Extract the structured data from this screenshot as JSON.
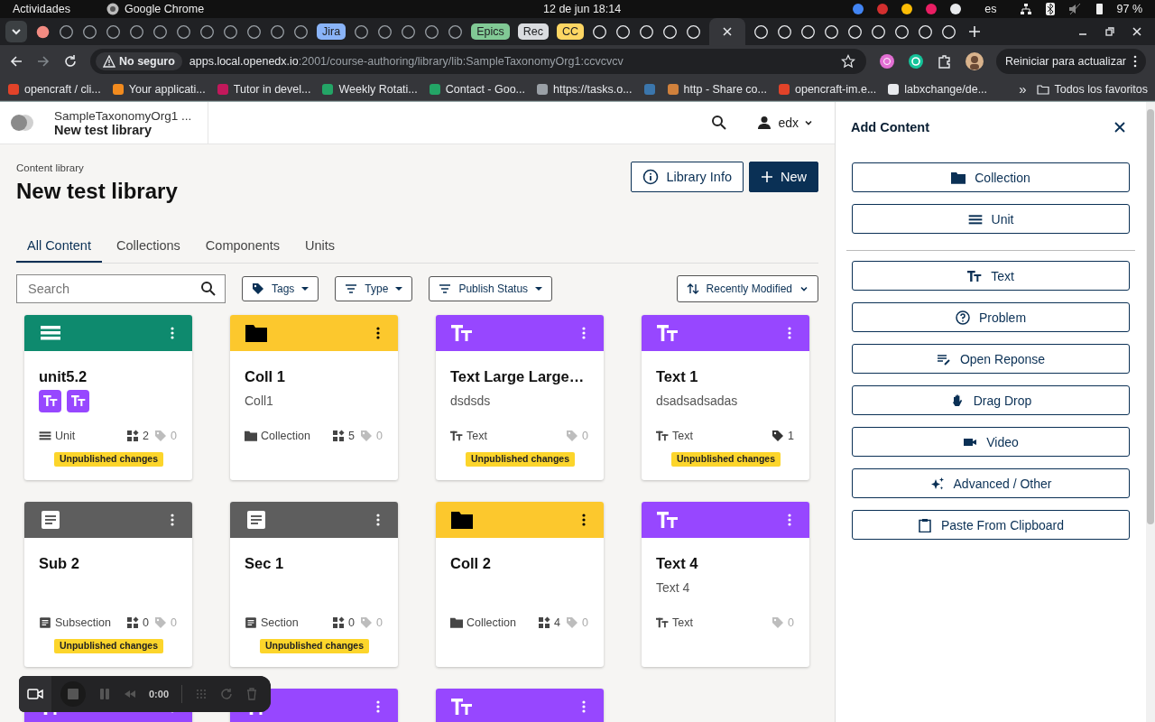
{
  "system_bar": {
    "activities": "Actividades",
    "app": "Google Chrome",
    "clock": "12 de jun  18:14",
    "language": "es",
    "battery": "97 %"
  },
  "browser": {
    "tab_groups": [
      {
        "label": "Jira",
        "color": "#8ab4f8"
      },
      {
        "label": "Epics",
        "color": "#81c995"
      },
      {
        "label": "Rec",
        "color": "#dadce0"
      },
      {
        "label": "CC",
        "color": "#fdd663"
      }
    ],
    "security": "No seguro",
    "url_host": "apps.local.openedx.io",
    "url_path": ":2001/course-authoring/library/lib:SampleTaxonomyOrg1:ccvcvcv",
    "update_button": "Reiniciar para actualizar",
    "bookmarks": [
      {
        "label": "opencraft / cli...",
        "color": "#e24329"
      },
      {
        "label": "Your applicati...",
        "color": "#f28b1e"
      },
      {
        "label": "Tutor in devel...",
        "color": "#c2185b"
      },
      {
        "label": "Weekly Rotati...",
        "color": "#23a566"
      },
      {
        "label": "Contact - Goo...",
        "color": "#23a566"
      },
      {
        "label": "https://tasks.o...",
        "color": "#9aa0a6"
      },
      {
        "color": "#3b76ac"
      },
      {
        "label": "http - Share co...",
        "color": "#d0813c"
      },
      {
        "label": "opencraft-im.e...",
        "color": "#e24329"
      },
      {
        "label": "labxchange/de...",
        "color": "#e8eaed"
      }
    ],
    "bookmarks_more": "»",
    "all_bookmarks": "Todos los favoritos"
  },
  "header": {
    "org": "SampleTaxonomyOrg1 ...",
    "library": "New test library",
    "user": "edx"
  },
  "page": {
    "breadcrumb": "Content library",
    "title": "New test library",
    "info_button": "Library Info",
    "new_button": "New"
  },
  "tabs": [
    {
      "label": "All Content",
      "selected": true
    },
    {
      "label": "Collections",
      "selected": false
    },
    {
      "label": "Components",
      "selected": false
    },
    {
      "label": "Units",
      "selected": false
    }
  ],
  "filters": {
    "search_placeholder": "Search",
    "buttons": [
      {
        "label": "Tags",
        "kind": "tag"
      },
      {
        "label": "Type",
        "kind": "filter"
      },
      {
        "label": "Publish Status",
        "kind": "filter"
      }
    ],
    "sort": "Recently Modified"
  },
  "cards": [
    {
      "kind": "unit",
      "title": "unit5.2",
      "children": [
        {
          "kind": "text"
        },
        {
          "kind": "text"
        }
      ],
      "type_label": "Unit",
      "components": "2",
      "tags": "0",
      "tagged": false,
      "unpublished": true,
      "badge": "Unpublished changes"
    },
    {
      "kind": "collection",
      "title": "Coll 1",
      "subtitle": "Coll1",
      "type_label": "Collection",
      "components": "5",
      "tags": "0",
      "tagged": false,
      "unpublished": false
    },
    {
      "kind": "text",
      "title": "Text Large Large…",
      "subtitle": "dsdsds",
      "type_label": "Text",
      "tags": "0",
      "tagged": false,
      "unpublished": true,
      "badge": "Unpublished changes"
    },
    {
      "kind": "text",
      "title": "Text 1",
      "subtitle": "dsadsadsadas",
      "type_label": "Text",
      "tags": "1",
      "tagged": true,
      "unpublished": true,
      "badge": "Unpublished changes"
    },
    {
      "kind": "subsection",
      "title": "Sub 2",
      "type_label": "Subsection",
      "components": "0",
      "tags": "0",
      "tagged": false,
      "unpublished": true,
      "badge": "Unpublished changes"
    },
    {
      "kind": "section",
      "title": "Sec 1",
      "type_label": "Section",
      "components": "0",
      "tags": "0",
      "tagged": false,
      "unpublished": true,
      "badge": "Unpublished changes"
    },
    {
      "kind": "collection",
      "title": "Coll 2",
      "type_label": "Collection",
      "components": "4",
      "tags": "0",
      "tagged": false,
      "unpublished": false
    },
    {
      "kind": "text",
      "title": "Text 4",
      "subtitle": "Text 4",
      "type_label": "Text",
      "tags": "0",
      "tagged": false,
      "unpublished": false
    },
    {
      "kind": "text"
    },
    {
      "kind": "text"
    },
    {
      "kind": "text"
    }
  ],
  "recorder": {
    "time": "0:00"
  },
  "panel": {
    "title": "Add Content",
    "primary_actions": [
      {
        "label": "Collection",
        "kind": "collection"
      },
      {
        "label": "Unit",
        "kind": "unit"
      }
    ],
    "block_actions": [
      {
        "label": "Text",
        "kind": "text"
      },
      {
        "label": "Problem",
        "kind": "problem"
      },
      {
        "label": "Open Reponse",
        "kind": "open_response"
      },
      {
        "label": "Drag Drop",
        "kind": "drag_drop"
      },
      {
        "label": "Video",
        "kind": "video"
      },
      {
        "label": "Advanced / Other",
        "kind": "advanced"
      },
      {
        "label": "Paste From Clipboard",
        "kind": "clipboard"
      }
    ]
  }
}
